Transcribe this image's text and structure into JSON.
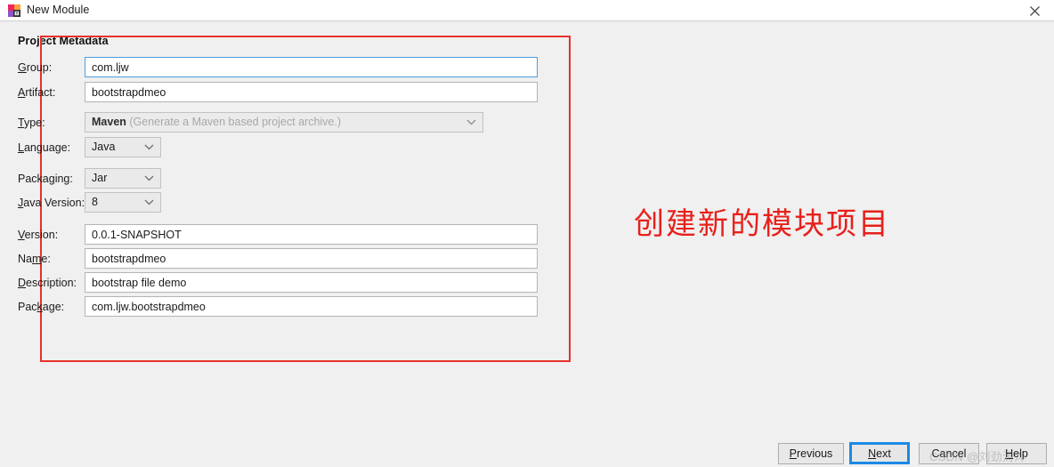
{
  "window": {
    "title": "New Module",
    "icon": "intellij-idea-icon",
    "close_icon": "close-icon"
  },
  "form": {
    "section_title": "Project Metadata",
    "rows": [
      {
        "label": "Group:",
        "mnemonic": "G",
        "control": "text",
        "value": "com.ljw",
        "focused": true
      },
      {
        "label": "Artifact:",
        "mnemonic": "A",
        "control": "text",
        "value": "bootstrapdmeo",
        "focused": false
      },
      {
        "label": "Type:",
        "mnemonic": "T",
        "control": "combo-disabled",
        "value": "Maven",
        "hint": "(Generate a Maven based project archive.)"
      },
      {
        "label": "Language:",
        "mnemonic": "L",
        "control": "combo",
        "value": "Java"
      },
      {
        "label": "Packaging:",
        "mnemonic": "g",
        "control": "combo",
        "value": "Jar"
      },
      {
        "label": "Java Version:",
        "mnemonic": "J",
        "control": "combo",
        "value": "8"
      },
      {
        "label": "Version:",
        "mnemonic": "V",
        "control": "text",
        "value": "0.0.1-SNAPSHOT",
        "focused": false
      },
      {
        "label": "Name:",
        "mnemonic": "m",
        "control": "text",
        "value": "bootstrapdmeo",
        "focused": false
      },
      {
        "label": "Description:",
        "mnemonic": "D",
        "control": "text",
        "value": "bootstrap file demo",
        "focused": false
      },
      {
        "label": "Package:",
        "mnemonic": "k",
        "control": "text",
        "value": "com.ljw.bootstrapdmeo",
        "focused": false
      }
    ]
  },
  "annotation": {
    "text": "创建新的模块项目",
    "color": "#e8201b",
    "rect_color": "#e8312a"
  },
  "buttons": {
    "previous": "Previous",
    "next": "Next",
    "cancel": "Cancel",
    "help": "Help"
  },
  "watermark": {
    "text": "CSDN @刘劲涛烨"
  }
}
